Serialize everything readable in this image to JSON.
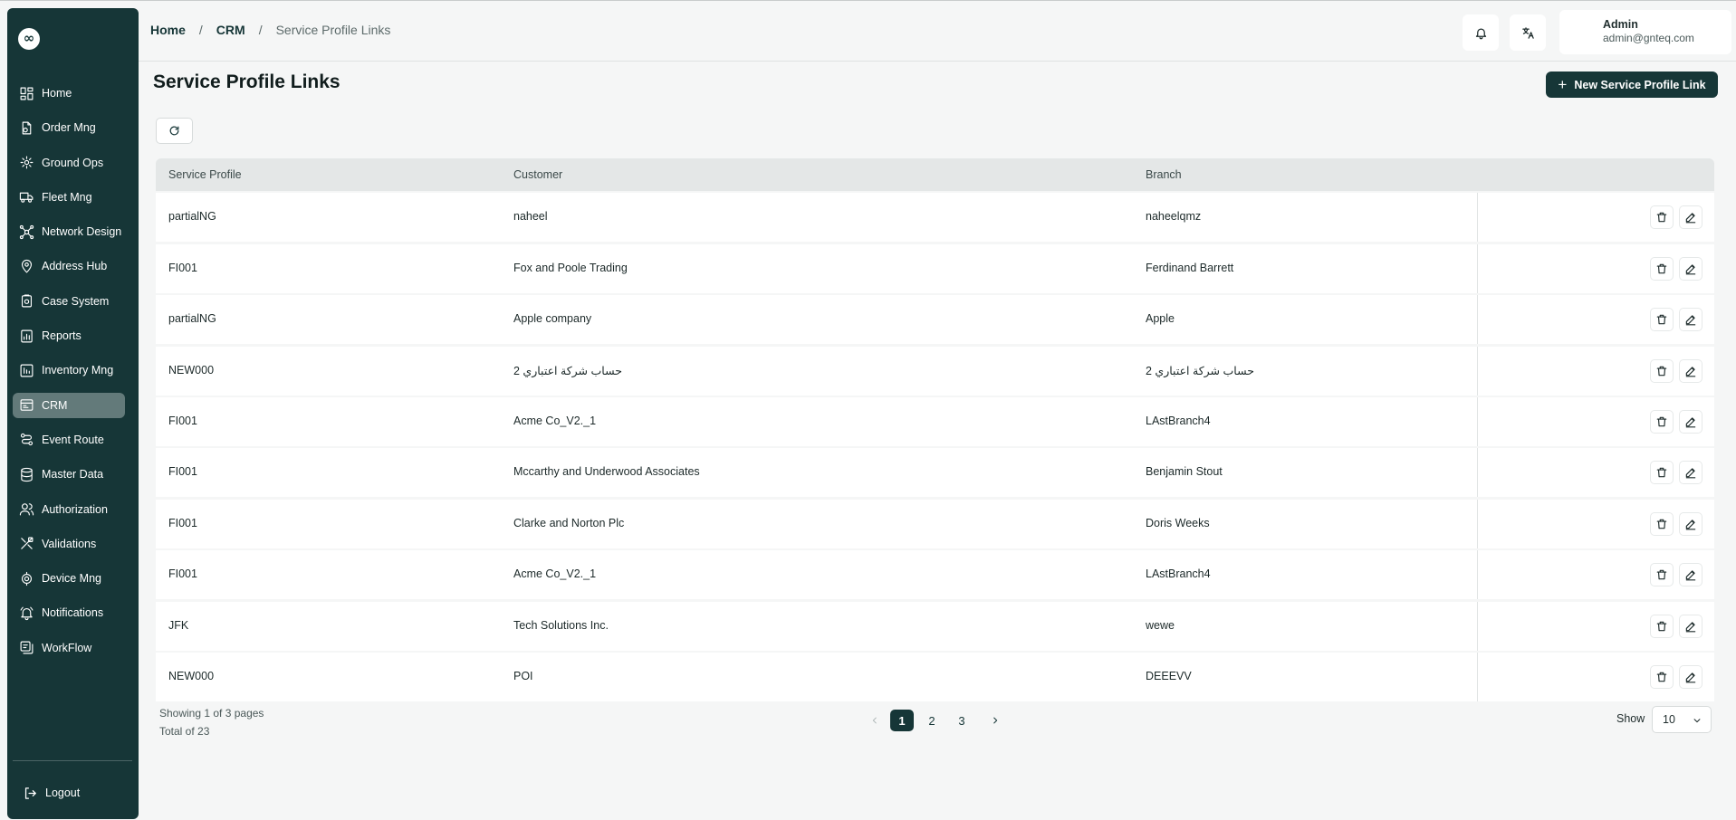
{
  "sidebar": {
    "logo": "∞",
    "items": [
      {
        "label": "Home",
        "icon": "home-icon"
      },
      {
        "label": "Order Mng",
        "icon": "order-icon"
      },
      {
        "label": "Ground Ops",
        "icon": "ground-ops-icon"
      },
      {
        "label": "Fleet Mng",
        "icon": "truck-icon"
      },
      {
        "label": "Network Design",
        "icon": "network-icon"
      },
      {
        "label": "Address Hub",
        "icon": "map-pin-icon"
      },
      {
        "label": "Case System",
        "icon": "case-icon"
      },
      {
        "label": "Reports",
        "icon": "reports-icon"
      },
      {
        "label": "Inventory Mng",
        "icon": "inventory-icon"
      },
      {
        "label": "CRM",
        "icon": "crm-icon",
        "active": true
      },
      {
        "label": "Event Route",
        "icon": "route-icon"
      },
      {
        "label": "Master Data",
        "icon": "database-icon"
      },
      {
        "label": "Authorization",
        "icon": "users-icon"
      },
      {
        "label": "Validations",
        "icon": "validations-icon"
      },
      {
        "label": "Device Mng",
        "icon": "device-icon"
      },
      {
        "label": "Notifications",
        "icon": "bell-icon"
      },
      {
        "label": "WorkFlow",
        "icon": "workflow-icon"
      }
    ],
    "logout_label": "Logout"
  },
  "header": {
    "breadcrumb": [
      "Home",
      "CRM",
      "Service Profile Links"
    ],
    "user": {
      "name": "Admin",
      "email": "admin@gnteq.com"
    }
  },
  "page": {
    "title": "Service Profile Links",
    "new_button_label": "New Service Profile Link"
  },
  "table": {
    "columns": [
      "Service Profile",
      "Customer",
      "Branch"
    ],
    "rows": [
      [
        "partialNG",
        "naheel",
        "naheelqmz"
      ],
      [
        "FI001",
        "Fox and Poole Trading",
        "Ferdinand Barrett"
      ],
      [
        "partialNG",
        "Apple company",
        "Apple"
      ],
      [
        "NEW000",
        "حساب شركة اعتباري 2",
        "حساب شركة اعتباري 2"
      ],
      [
        "FI001",
        "Acme Co_V2._1",
        "LAstBranch4"
      ],
      [
        "FI001",
        "Mccarthy and Underwood Associates",
        "Benjamin Stout"
      ],
      [
        "FI001",
        "Clarke and Norton Plc",
        "Doris Weeks"
      ],
      [
        "FI001",
        "Acme Co_V2._1",
        "LAstBranch4"
      ],
      [
        "JFK",
        "Tech Solutions Inc.",
        "wewe"
      ],
      [
        "NEW000",
        "POI",
        "DEEEVV"
      ]
    ]
  },
  "pagination": {
    "showing": "Showing 1 of 3 pages",
    "total": "Total of 23",
    "pages": [
      "1",
      "2",
      "3"
    ],
    "current": "1",
    "show_label": "Show",
    "page_size": "10"
  },
  "colors": {
    "sidebar_bg": "#163637",
    "active_item": "#637a7a",
    "accent": "#163637"
  }
}
